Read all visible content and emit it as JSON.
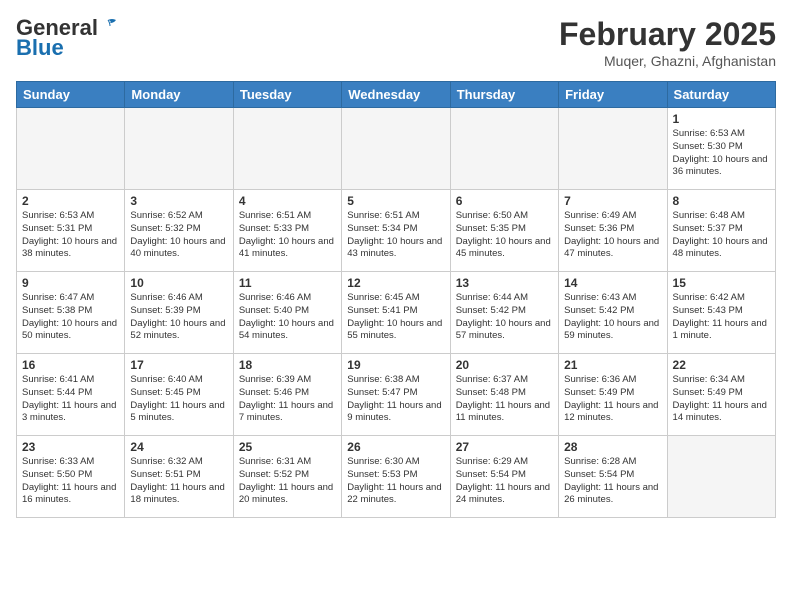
{
  "header": {
    "logo_general": "General",
    "logo_blue": "Blue",
    "month": "February 2025",
    "location": "Muqer, Ghazni, Afghanistan"
  },
  "weekdays": [
    "Sunday",
    "Monday",
    "Tuesday",
    "Wednesday",
    "Thursday",
    "Friday",
    "Saturday"
  ],
  "weeks": [
    [
      {
        "day": "",
        "empty": true
      },
      {
        "day": "",
        "empty": true
      },
      {
        "day": "",
        "empty": true
      },
      {
        "day": "",
        "empty": true
      },
      {
        "day": "",
        "empty": true
      },
      {
        "day": "",
        "empty": true
      },
      {
        "day": "1",
        "sunrise": "6:53 AM",
        "sunset": "5:30 PM",
        "daylight": "10 hours and 36 minutes."
      }
    ],
    [
      {
        "day": "2",
        "sunrise": "6:53 AM",
        "sunset": "5:31 PM",
        "daylight": "10 hours and 38 minutes."
      },
      {
        "day": "3",
        "sunrise": "6:52 AM",
        "sunset": "5:32 PM",
        "daylight": "10 hours and 40 minutes."
      },
      {
        "day": "4",
        "sunrise": "6:51 AM",
        "sunset": "5:33 PM",
        "daylight": "10 hours and 41 minutes."
      },
      {
        "day": "5",
        "sunrise": "6:51 AM",
        "sunset": "5:34 PM",
        "daylight": "10 hours and 43 minutes."
      },
      {
        "day": "6",
        "sunrise": "6:50 AM",
        "sunset": "5:35 PM",
        "daylight": "10 hours and 45 minutes."
      },
      {
        "day": "7",
        "sunrise": "6:49 AM",
        "sunset": "5:36 PM",
        "daylight": "10 hours and 47 minutes."
      },
      {
        "day": "8",
        "sunrise": "6:48 AM",
        "sunset": "5:37 PM",
        "daylight": "10 hours and 48 minutes."
      }
    ],
    [
      {
        "day": "9",
        "sunrise": "6:47 AM",
        "sunset": "5:38 PM",
        "daylight": "10 hours and 50 minutes."
      },
      {
        "day": "10",
        "sunrise": "6:46 AM",
        "sunset": "5:39 PM",
        "daylight": "10 hours and 52 minutes."
      },
      {
        "day": "11",
        "sunrise": "6:46 AM",
        "sunset": "5:40 PM",
        "daylight": "10 hours and 54 minutes."
      },
      {
        "day": "12",
        "sunrise": "6:45 AM",
        "sunset": "5:41 PM",
        "daylight": "10 hours and 55 minutes."
      },
      {
        "day": "13",
        "sunrise": "6:44 AM",
        "sunset": "5:42 PM",
        "daylight": "10 hours and 57 minutes."
      },
      {
        "day": "14",
        "sunrise": "6:43 AM",
        "sunset": "5:42 PM",
        "daylight": "10 hours and 59 minutes."
      },
      {
        "day": "15",
        "sunrise": "6:42 AM",
        "sunset": "5:43 PM",
        "daylight": "11 hours and 1 minute."
      }
    ],
    [
      {
        "day": "16",
        "sunrise": "6:41 AM",
        "sunset": "5:44 PM",
        "daylight": "11 hours and 3 minutes."
      },
      {
        "day": "17",
        "sunrise": "6:40 AM",
        "sunset": "5:45 PM",
        "daylight": "11 hours and 5 minutes."
      },
      {
        "day": "18",
        "sunrise": "6:39 AM",
        "sunset": "5:46 PM",
        "daylight": "11 hours and 7 minutes."
      },
      {
        "day": "19",
        "sunrise": "6:38 AM",
        "sunset": "5:47 PM",
        "daylight": "11 hours and 9 minutes."
      },
      {
        "day": "20",
        "sunrise": "6:37 AM",
        "sunset": "5:48 PM",
        "daylight": "11 hours and 11 minutes."
      },
      {
        "day": "21",
        "sunrise": "6:36 AM",
        "sunset": "5:49 PM",
        "daylight": "11 hours and 12 minutes."
      },
      {
        "day": "22",
        "sunrise": "6:34 AM",
        "sunset": "5:49 PM",
        "daylight": "11 hours and 14 minutes."
      }
    ],
    [
      {
        "day": "23",
        "sunrise": "6:33 AM",
        "sunset": "5:50 PM",
        "daylight": "11 hours and 16 minutes."
      },
      {
        "day": "24",
        "sunrise": "6:32 AM",
        "sunset": "5:51 PM",
        "daylight": "11 hours and 18 minutes."
      },
      {
        "day": "25",
        "sunrise": "6:31 AM",
        "sunset": "5:52 PM",
        "daylight": "11 hours and 20 minutes."
      },
      {
        "day": "26",
        "sunrise": "6:30 AM",
        "sunset": "5:53 PM",
        "daylight": "11 hours and 22 minutes."
      },
      {
        "day": "27",
        "sunrise": "6:29 AM",
        "sunset": "5:54 PM",
        "daylight": "11 hours and 24 minutes."
      },
      {
        "day": "28",
        "sunrise": "6:28 AM",
        "sunset": "5:54 PM",
        "daylight": "11 hours and 26 minutes."
      },
      {
        "day": "",
        "empty": true
      }
    ]
  ]
}
